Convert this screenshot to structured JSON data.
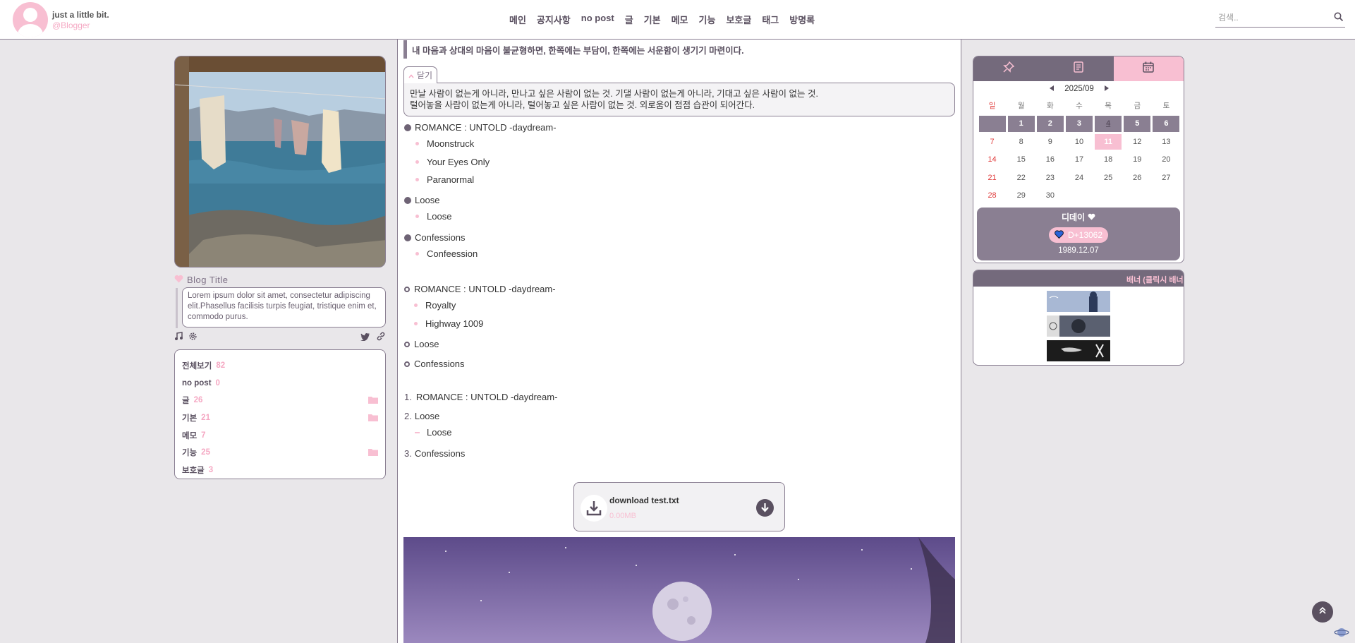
{
  "header": {
    "blog_name": "just a little bit.",
    "handle": "@Blogger",
    "nav": [
      "메인",
      "공지사항",
      "no post",
      "글",
      "기본",
      "메모",
      "기능",
      "보호글",
      "태그",
      "방명록"
    ],
    "search_placeholder": "검색.."
  },
  "sidebar": {
    "blog_title": "Blog Title",
    "description": "Lorem ipsum dolor sit amet, consectetur adipiscing elit.Phasellus facilisis turpis feugiat, tristique enim et, commodo purus.",
    "categories": [
      {
        "label": "전체보기",
        "count": "82",
        "folder": false
      },
      {
        "label": "no post",
        "count": "0",
        "folder": false
      },
      {
        "label": "글",
        "count": "26",
        "folder": true
      },
      {
        "label": "기본",
        "count": "21",
        "folder": true
      },
      {
        "label": "메모",
        "count": "7",
        "folder": false
      },
      {
        "label": "기능",
        "count": "25",
        "folder": true
      },
      {
        "label": "보호글",
        "count": "3",
        "folder": false
      }
    ]
  },
  "content": {
    "quote": "내 마음과 상대의 마음이 불균형하면, 한쪽에는 부담이, 한쪽에는 서운함이 생기기 마련이다.",
    "fold_label": "닫기",
    "fold_line1": "만날 사람이 없는게 아니라, 만나고 싶은 사람이 없는 것. 기댈 사람이 없는게 아니라, 기대고 싶은 사람이 없는 것.",
    "fold_line2": "털어놓을 사람이 없는게 아니라, 털어놓고 싶은 사람이 없는 것. 외로움이 점점 습관이 되어간다.",
    "list1": [
      {
        "title": "ROMANCE : UNTOLD -daydream-",
        "items": [
          "Moonstruck",
          "Your Eyes Only",
          "Paranormal"
        ]
      },
      {
        "title": "Loose",
        "items": [
          "Loose"
        ]
      },
      {
        "title": "Confessions",
        "items": [
          "Confeession"
        ]
      }
    ],
    "list2": [
      {
        "title": "ROMANCE : UNTOLD -daydream-",
        "items": [
          "Royalty",
          "Highway 1009"
        ]
      },
      {
        "title": "Loose",
        "items": []
      },
      {
        "title": "Confessions",
        "items": []
      }
    ],
    "list3": [
      {
        "num": "1.",
        "title": "ROMANCE : UNTOLD -daydream-",
        "items": []
      },
      {
        "num": "2.",
        "title": "Loose",
        "items": [
          "Loose"
        ]
      },
      {
        "num": "3.",
        "title": "Confessions",
        "items": []
      }
    ],
    "file": {
      "name": "download test.txt",
      "size": "0.00MB"
    }
  },
  "calendar": {
    "month": "2025/09",
    "weekdays": [
      "일",
      "월",
      "화",
      "수",
      "목",
      "금",
      "토"
    ],
    "today": "11",
    "dday_title": "디데이",
    "dday_value": "D+13062",
    "dday_date": "1989.12.07"
  },
  "banner": {
    "title": "배너 (클릭시 배너"
  },
  "colors": {
    "accent": "#f8bfd2",
    "primary": "#8a7f92",
    "dark": "#5a5060",
    "tab": "#746a7c"
  }
}
